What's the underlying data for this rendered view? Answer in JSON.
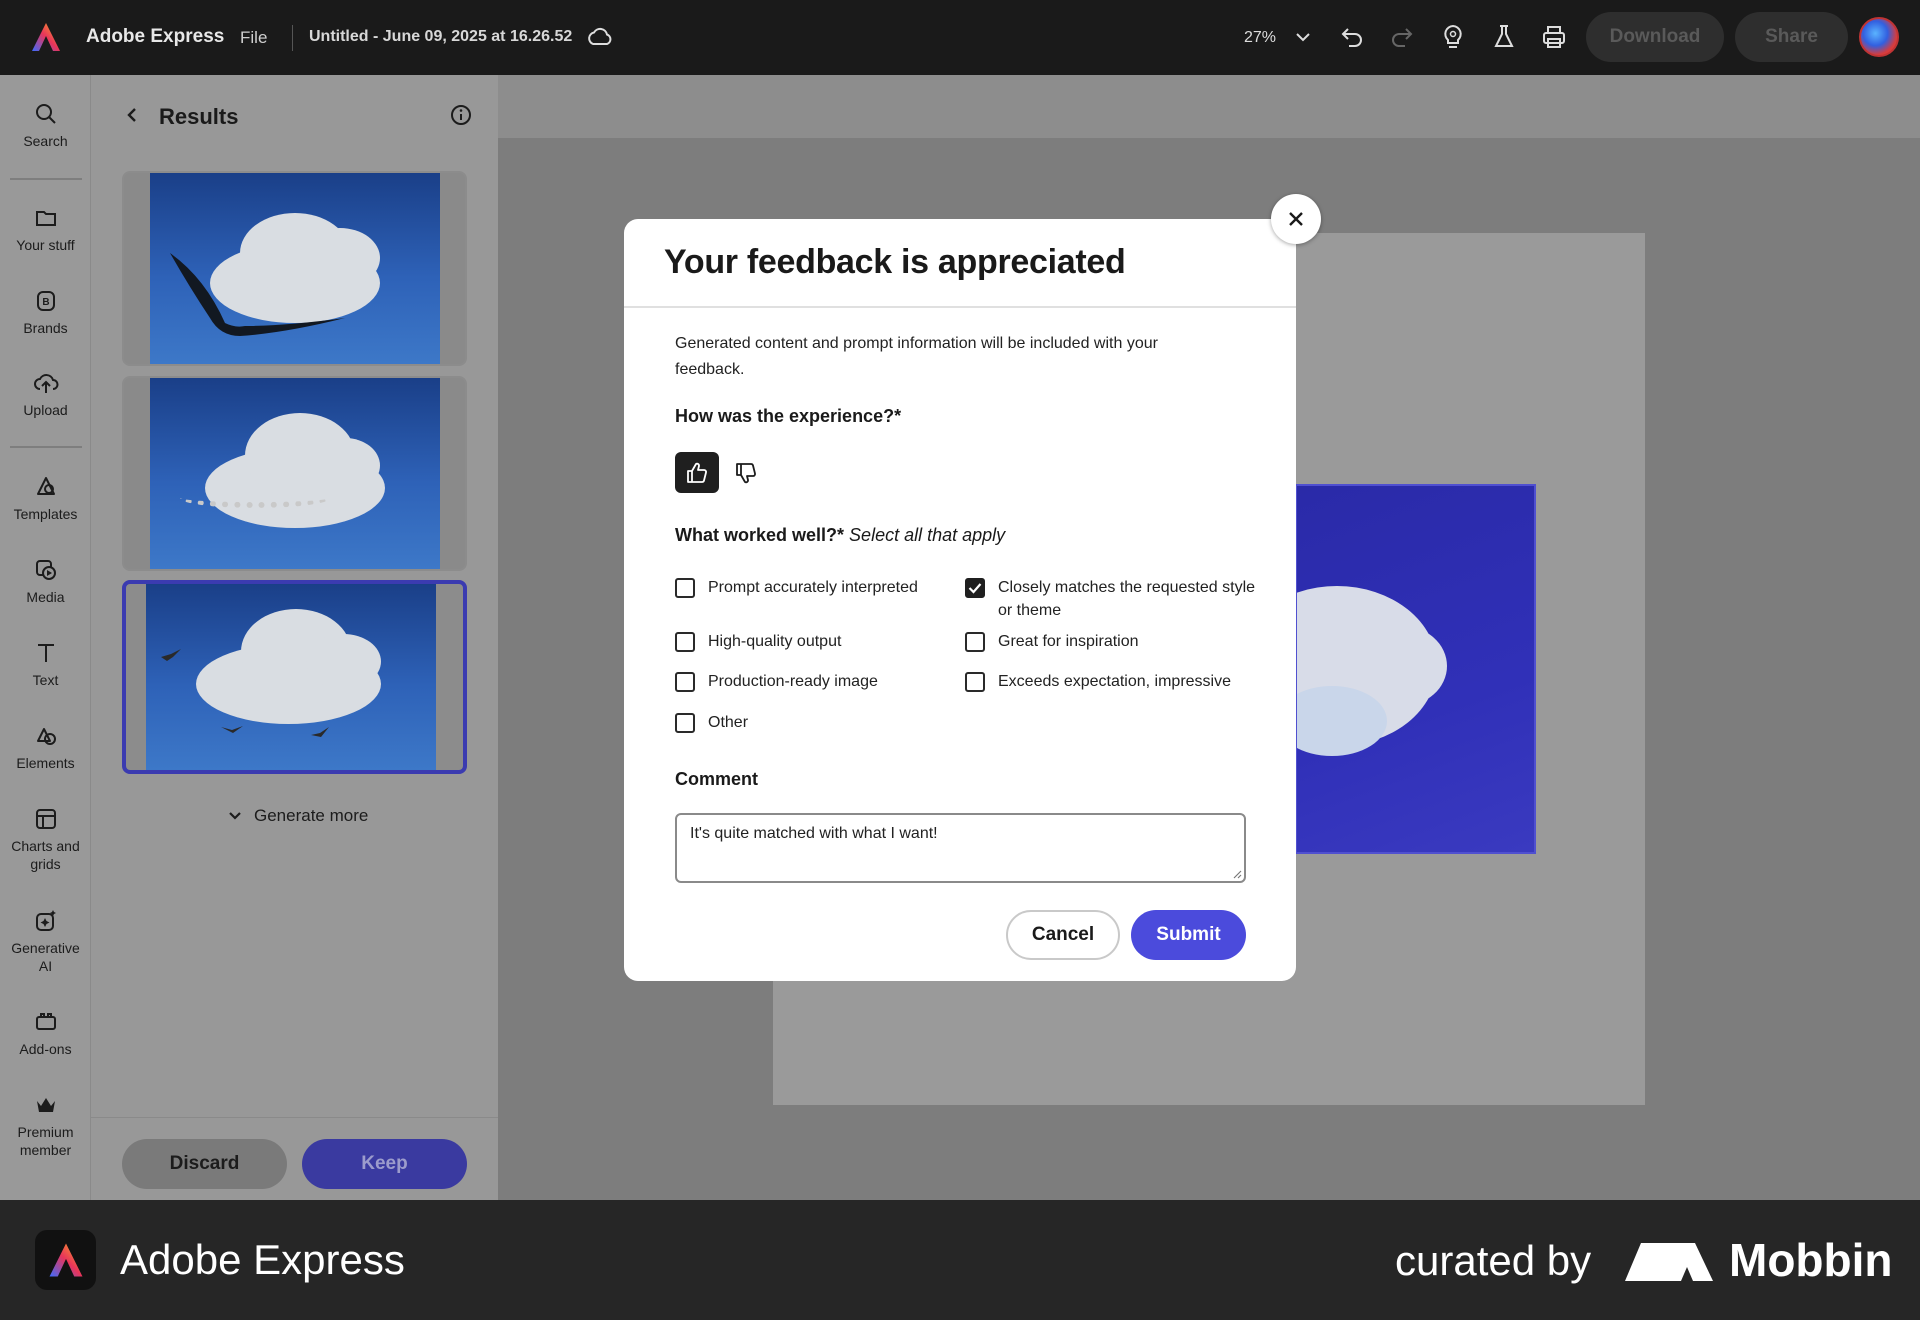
{
  "header": {
    "app_name": "Adobe Express",
    "file_menu": "File",
    "doc_title": "Untitled - June 09, 2025 at 16.26.52",
    "zoom": "27%",
    "download_label": "Download",
    "share_label": "Share"
  },
  "rail": {
    "items": [
      {
        "label": "Search",
        "icon": "search-icon"
      },
      {
        "label": "Your stuff",
        "icon": "folder-icon"
      },
      {
        "label": "Brands",
        "icon": "brand-icon"
      },
      {
        "label": "Upload",
        "icon": "upload-icon"
      },
      {
        "label": "Templates",
        "icon": "templates-icon"
      },
      {
        "label": "Media",
        "icon": "media-icon"
      },
      {
        "label": "Text",
        "icon": "text-icon"
      },
      {
        "label": "Elements",
        "icon": "elements-icon"
      },
      {
        "label": "Charts and grids",
        "icon": "charts-icon"
      },
      {
        "label": "Generative AI",
        "icon": "generative-ai-icon"
      },
      {
        "label": "Add-ons",
        "icon": "add-ons-icon"
      },
      {
        "label": "Premium member",
        "icon": "crown-icon"
      }
    ]
  },
  "panel": {
    "title": "Results",
    "generate_more": "Generate more",
    "discard_label": "Discard",
    "keep_label": "Keep"
  },
  "modal": {
    "title": "Your feedback is appreciated",
    "description": "Generated content and prompt information will be included with your feedback.",
    "question_experience": "How was the experience?*",
    "question_worked_bold": "What worked well?*",
    "question_worked_italic": "Select all that apply",
    "options": [
      {
        "label": "Prompt accurately interpreted",
        "checked": false
      },
      {
        "label": "High-quality output",
        "checked": false
      },
      {
        "label": "Production-ready image",
        "checked": false
      },
      {
        "label": "Other",
        "checked": false
      },
      {
        "label": "Closely matches the requested style or theme",
        "checked": true
      },
      {
        "label": "Great for inspiration",
        "checked": false
      },
      {
        "label": "Exceeds expectation, impressive",
        "checked": false
      }
    ],
    "comment_label": "Comment",
    "comment_value": "It's quite matched with what I want!",
    "cancel_label": "Cancel",
    "submit_label": "Submit"
  },
  "footer": {
    "app_name": "Adobe Express",
    "curated_by": "curated by",
    "brand": "Mobbin"
  },
  "colors": {
    "accent": "#4b4bdc",
    "topbar": "#1a1a1a",
    "footer": "#262626"
  }
}
